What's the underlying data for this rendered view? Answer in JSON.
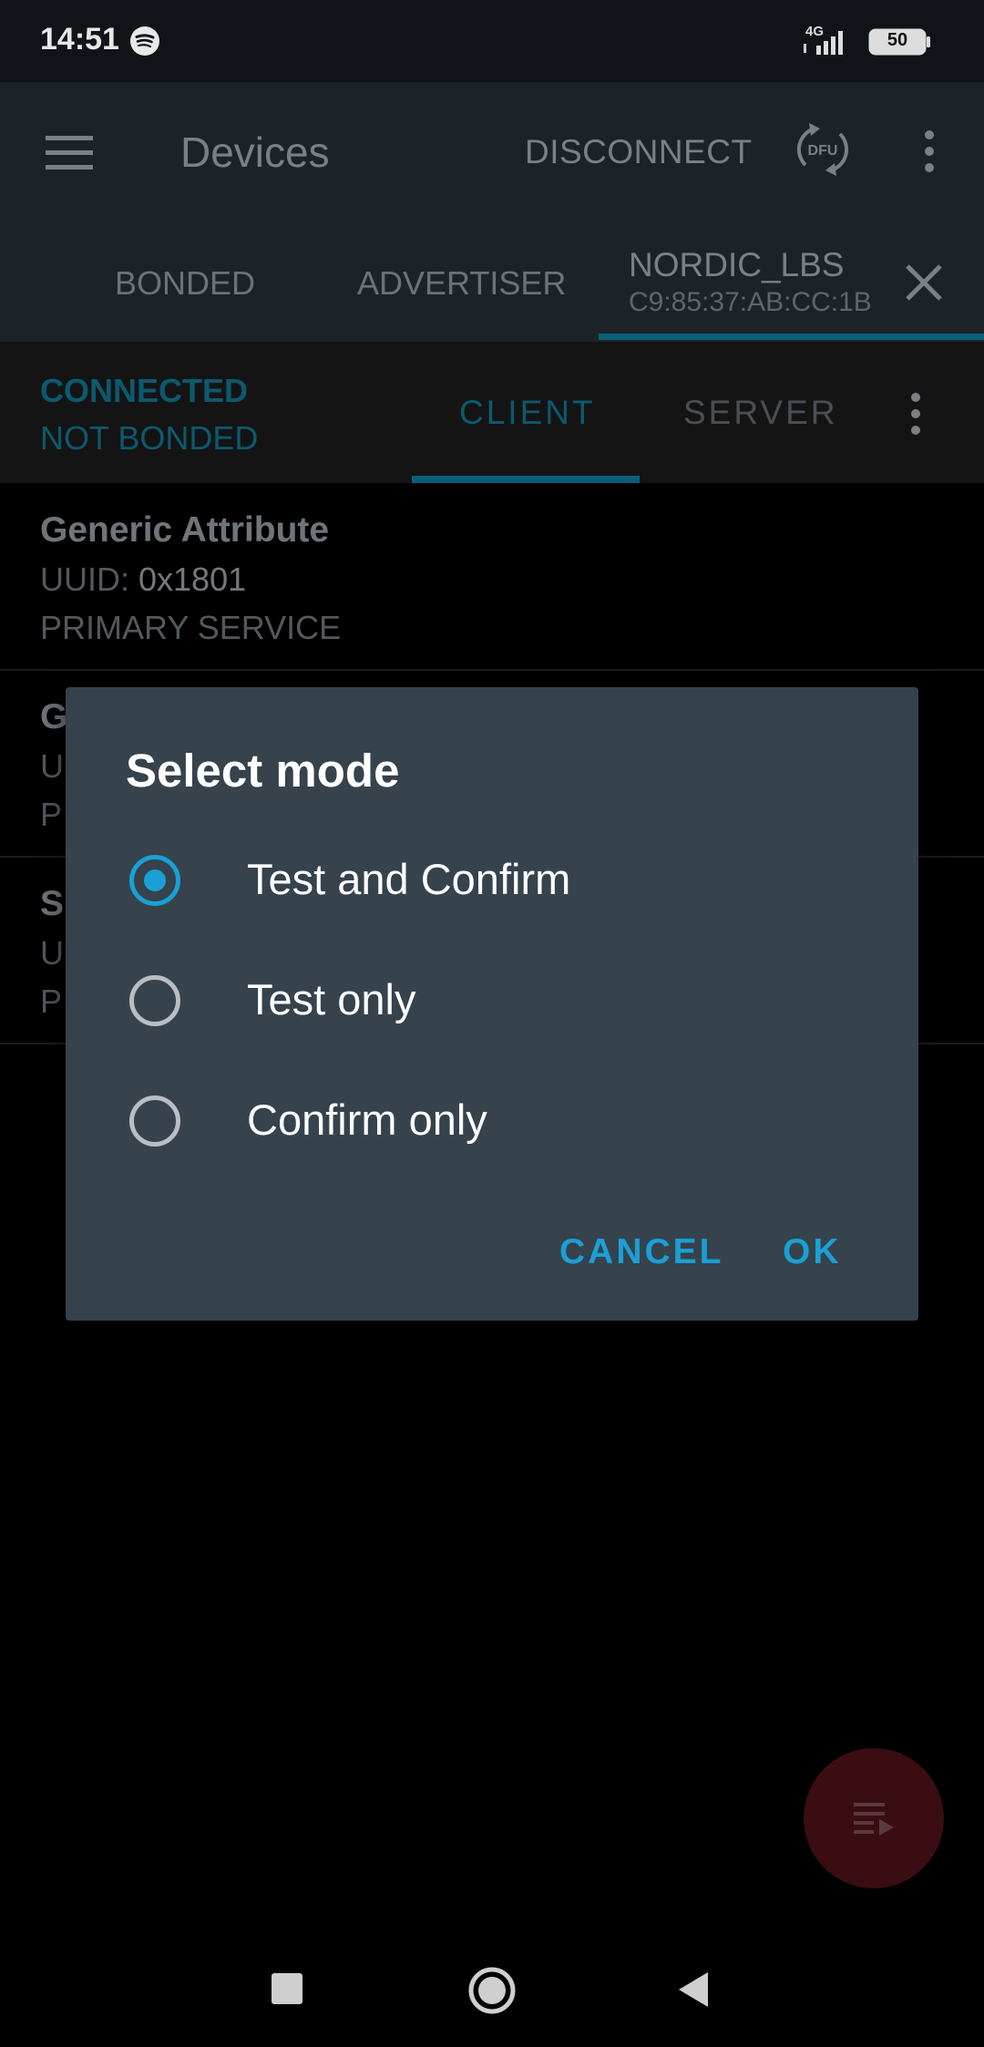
{
  "status_bar": {
    "time": "14:51",
    "network_type": "4G",
    "battery_level": "50"
  },
  "app_bar": {
    "title": "Devices",
    "disconnect_label": "DISCONNECT",
    "dfu_label": "DFU",
    "tabs": [
      {
        "label": "BONDED"
      },
      {
        "label": "ADVERTISER"
      },
      {
        "label": "NORDIC_LBS",
        "sublabel": "C9:85:37:AB:CC:1B",
        "selected": true
      }
    ]
  },
  "connection": {
    "status": "CONNECTED",
    "bond_status": "NOT BONDED",
    "tabs": [
      {
        "label": "CLIENT",
        "selected": true
      },
      {
        "label": "SERVER"
      }
    ]
  },
  "services": [
    {
      "name": "Generic Attribute",
      "uuid_label": "UUID:",
      "uuid": "0x1801",
      "type": "PRIMARY SERVICE"
    },
    {
      "name": "G",
      "uuid_label": "U",
      "uuid": "",
      "type": "P"
    },
    {
      "name": "S",
      "uuid_label": "U",
      "uuid": "",
      "type": "P"
    }
  ],
  "dialog": {
    "title": "Select mode",
    "options": [
      {
        "label": "Test and Confirm",
        "selected": true
      },
      {
        "label": "Test only",
        "selected": false
      },
      {
        "label": "Confirm only",
        "selected": false
      }
    ],
    "cancel_label": "CANCEL",
    "ok_label": "OK"
  },
  "colors": {
    "accent": "#1aa0d6",
    "dialog_bg": "#36424c",
    "app_bar_bg": "#1b2328",
    "fab_bg": "#3a0d12"
  },
  "icons": [
    "spotify-icon",
    "signal-icon",
    "battery-icon",
    "menu-icon",
    "dfu-icon",
    "more-vert-icon",
    "close-icon",
    "log-list-icon",
    "square-icon",
    "circle-icon",
    "triangle-back-icon"
  ]
}
